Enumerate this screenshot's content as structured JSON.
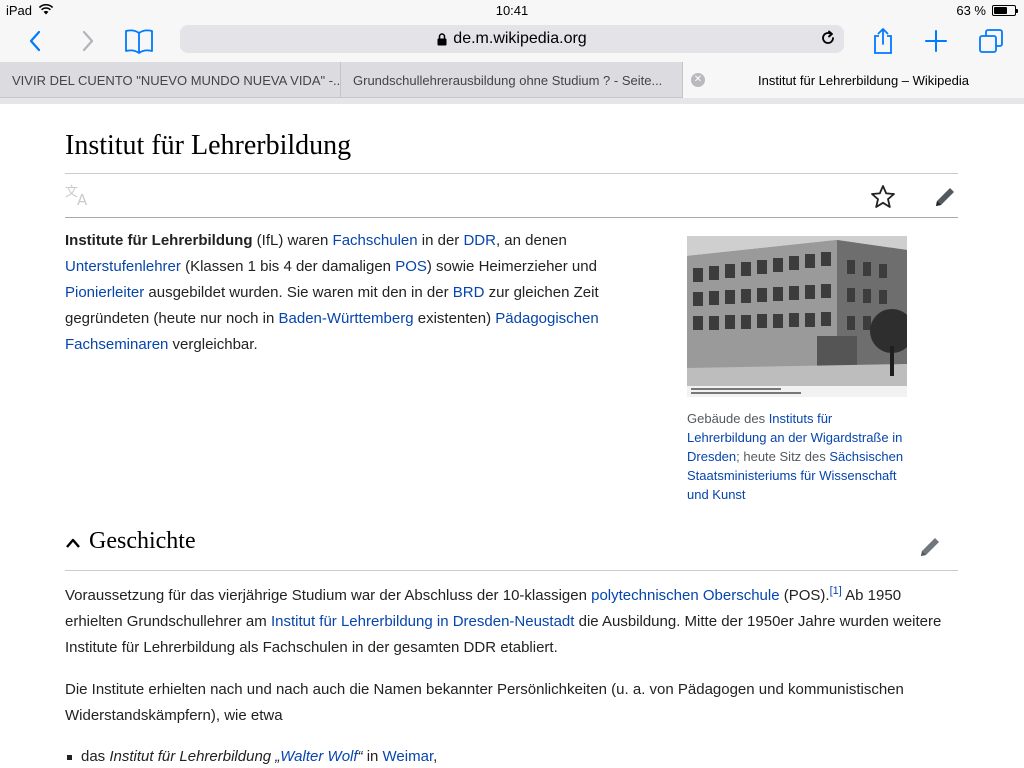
{
  "statusbar": {
    "device": "iPad",
    "time": "10:41",
    "battery": "63 %",
    "battery_level": 0.63
  },
  "toolbar": {
    "url": "de.m.wikipedia.org"
  },
  "tabs": [
    {
      "label": "VIVIR DEL CUENTO \"NUEVO MUNDO NUEVA VIDA\" -..."
    },
    {
      "label": "Grundschullehrerausbildung ohne Studium ? - Seite..."
    },
    {
      "label": "Institut für Lehrerbildung – Wikipedia"
    }
  ],
  "article": {
    "title": "Institut für Lehrerbildung",
    "lead": {
      "bold": "Institute für Lehrerbildung",
      "t1": " (IfL) waren ",
      "l1": "Fachschulen",
      "t2": " in der ",
      "l2": "DDR",
      "t3": ", an denen ",
      "l3": "Unterstufenlehrer",
      "t4": " (Klassen 1 bis 4 der damaligen ",
      "l4": "POS",
      "t5": ") sowie Heimerzieher und ",
      "l5": "Pionierleiter",
      "t6": " ausgebildet wurden. Sie waren mit den in der ",
      "l6": "BRD",
      "t7": " zur gleichen Zeit gegründeten (heute nur noch in ",
      "l7": "Baden-Württemberg",
      "t8": " existenten) ",
      "l8": "Pädagogischen Fachseminaren",
      "t9": " vergleichbar."
    },
    "image_caption": {
      "t1": "Gebäude des ",
      "l1": "Instituts für Lehrerbildung an der Wigardstraße in Dresden",
      "t2": "; heute Sitz des ",
      "l2": "Sächsischen Staatsministeriums für Wissenschaft und Kunst"
    },
    "section": {
      "heading": "Geschichte",
      "p1": {
        "t1": "Voraussetzung für das vierjährige Studium war der Abschluss der 10-klassigen ",
        "l1": "polytechnischen Oberschule",
        "t2": " (POS).",
        "ref": "[1]",
        "t3": " Ab 1950 erhielten Grundschullehrer am ",
        "l2": "Institut für Lehrerbildung in Dresden-Neustadt",
        "t4": " die Ausbildung. Mitte der 1950er Jahre wurden weitere Institute für Lehrerbildung als Fachschulen in der gesamten DDR etabliert."
      },
      "p2": "Die Institute erhielten nach und nach auch die Namen bekannter Persönlichkeiten (u. a. von Pädagogen und kommunistischen Widerstandskämpfern), wie etwa",
      "bullet": {
        "t1": "das ",
        "i1": "Institut für Lehrerbildung „",
        "l1": "Walter Wolf",
        "i2": "“",
        "t2": " in ",
        "l2": "Weimar",
        "t3": ","
      }
    }
  },
  "colors": {
    "link": "#0645ad",
    "ios_blue": "#007aff",
    "text": "#222222"
  },
  "icons": [
    "wifi-icon",
    "battery-icon",
    "back-icon",
    "forward-icon",
    "bookmarks-icon",
    "lock-icon",
    "reload-icon",
    "share-icon",
    "new-tab-icon",
    "tabs-icon",
    "tab-close-icon",
    "language-icon",
    "star-icon",
    "edit-icon",
    "chevron-up-icon"
  ]
}
